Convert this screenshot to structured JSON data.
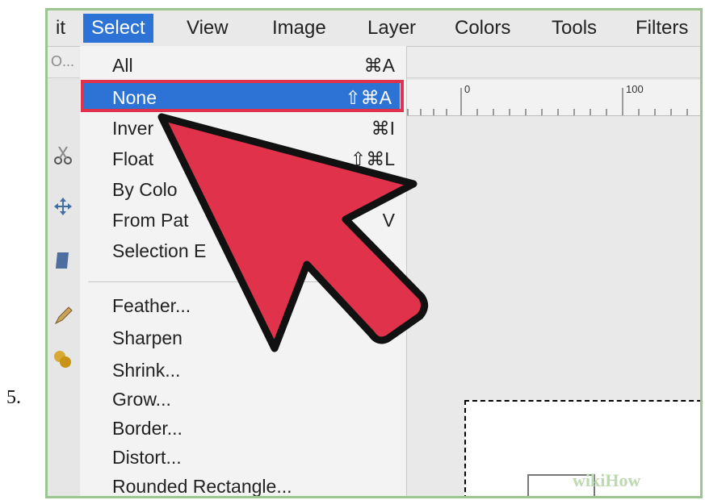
{
  "step": {
    "number": "5."
  },
  "menubar": {
    "items": [
      {
        "label": "it"
      },
      {
        "label": "Select"
      },
      {
        "label": "View"
      },
      {
        "label": "Image"
      },
      {
        "label": "Layer"
      },
      {
        "label": "Colors"
      },
      {
        "label": "Tools"
      },
      {
        "label": "Filters"
      }
    ]
  },
  "toolbar": {
    "tool_options_label": "O..."
  },
  "ruler": {
    "labels": [
      "0",
      "100"
    ]
  },
  "select_menu": {
    "items": [
      {
        "label": "All",
        "shortcut": "⌘A"
      },
      {
        "label": "None",
        "shortcut": "⇧⌘A"
      },
      {
        "label": "Inver",
        "shortcut": "⌘I"
      },
      {
        "label": "Float",
        "shortcut": "⇧⌘L"
      },
      {
        "label": "By Colo",
        "shortcut": ""
      },
      {
        "label": "From Pat",
        "shortcut": "V"
      },
      {
        "label": "Selection E",
        "shortcut": ""
      },
      {
        "label": "Feather...",
        "shortcut": ""
      },
      {
        "label": "Sharpen",
        "shortcut": ""
      },
      {
        "label": "Shrink...",
        "shortcut": ""
      },
      {
        "label": "Grow...",
        "shortcut": ""
      },
      {
        "label": "Border...",
        "shortcut": ""
      },
      {
        "label": "Distort...",
        "shortcut": ""
      },
      {
        "label": "Rounded Rectangle...",
        "shortcut": ""
      }
    ]
  },
  "watermark": {
    "text": "wikiHow"
  },
  "colors": {
    "highlight": "#2d73d6",
    "arrow": "#e0334b",
    "callout_border": "#e0334b"
  },
  "icons": [
    "scissors-icon",
    "move-icon",
    "bucket-icon",
    "pencil-icon",
    "clone-icon"
  ]
}
